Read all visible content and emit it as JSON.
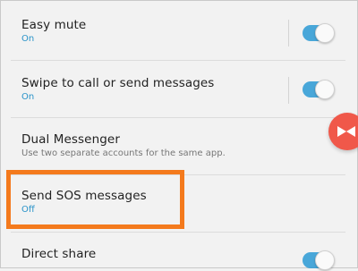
{
  "settings": [
    {
      "title": "Easy mute",
      "subtitle": "On",
      "toggle": "on"
    },
    {
      "title": "Swipe to call or send messages",
      "subtitle": "On",
      "toggle": "on"
    },
    {
      "title": "Dual Messenger",
      "description": "Use two separate accounts for the same app."
    },
    {
      "title": "Send SOS messages",
      "subtitle": "Off"
    },
    {
      "title": "Direct share",
      "toggle": "on"
    }
  ],
  "floating_button": {
    "icon": "close-x-icon"
  },
  "colors": {
    "accent": "#2b9ad5",
    "highlight": "#f47a1d",
    "floating": "#f0584a"
  }
}
